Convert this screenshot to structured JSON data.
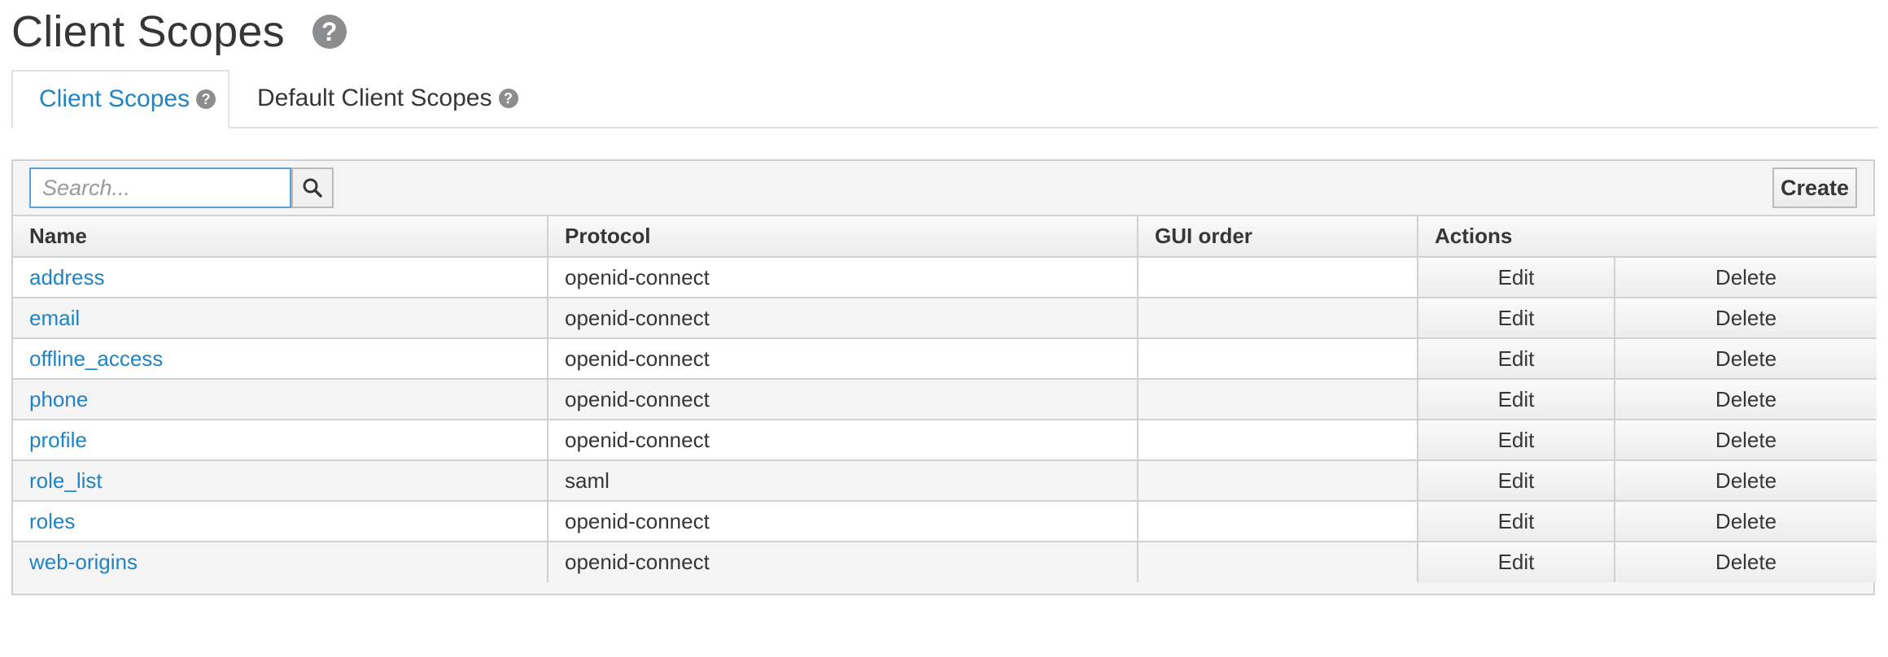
{
  "page": {
    "title": "Client Scopes"
  },
  "icons": {
    "help": "question-circle-icon",
    "search": "search-icon"
  },
  "colors": {
    "link": "#1f83c4",
    "help_icon": "#8b8d8f",
    "search_focus_border": "#5a9fd8"
  },
  "tabs": [
    {
      "label": "Client Scopes",
      "active": true
    },
    {
      "label": "Default Client Scopes",
      "active": false
    }
  ],
  "toolbar": {
    "search_placeholder": "Search...",
    "create_label": "Create"
  },
  "table": {
    "columns": [
      "Name",
      "Protocol",
      "GUI order",
      "Actions"
    ],
    "rows": [
      {
        "name": "address",
        "protocol": "openid-connect",
        "gui_order": "",
        "edit": "Edit",
        "delete": "Delete"
      },
      {
        "name": "email",
        "protocol": "openid-connect",
        "gui_order": "",
        "edit": "Edit",
        "delete": "Delete"
      },
      {
        "name": "offline_access",
        "protocol": "openid-connect",
        "gui_order": "",
        "edit": "Edit",
        "delete": "Delete"
      },
      {
        "name": "phone",
        "protocol": "openid-connect",
        "gui_order": "",
        "edit": "Edit",
        "delete": "Delete"
      },
      {
        "name": "profile",
        "protocol": "openid-connect",
        "gui_order": "",
        "edit": "Edit",
        "delete": "Delete"
      },
      {
        "name": "role_list",
        "protocol": "saml",
        "gui_order": "",
        "edit": "Edit",
        "delete": "Delete"
      },
      {
        "name": "roles",
        "protocol": "openid-connect",
        "gui_order": "",
        "edit": "Edit",
        "delete": "Delete"
      },
      {
        "name": "web-origins",
        "protocol": "openid-connect",
        "gui_order": "",
        "edit": "Edit",
        "delete": "Delete"
      }
    ]
  }
}
